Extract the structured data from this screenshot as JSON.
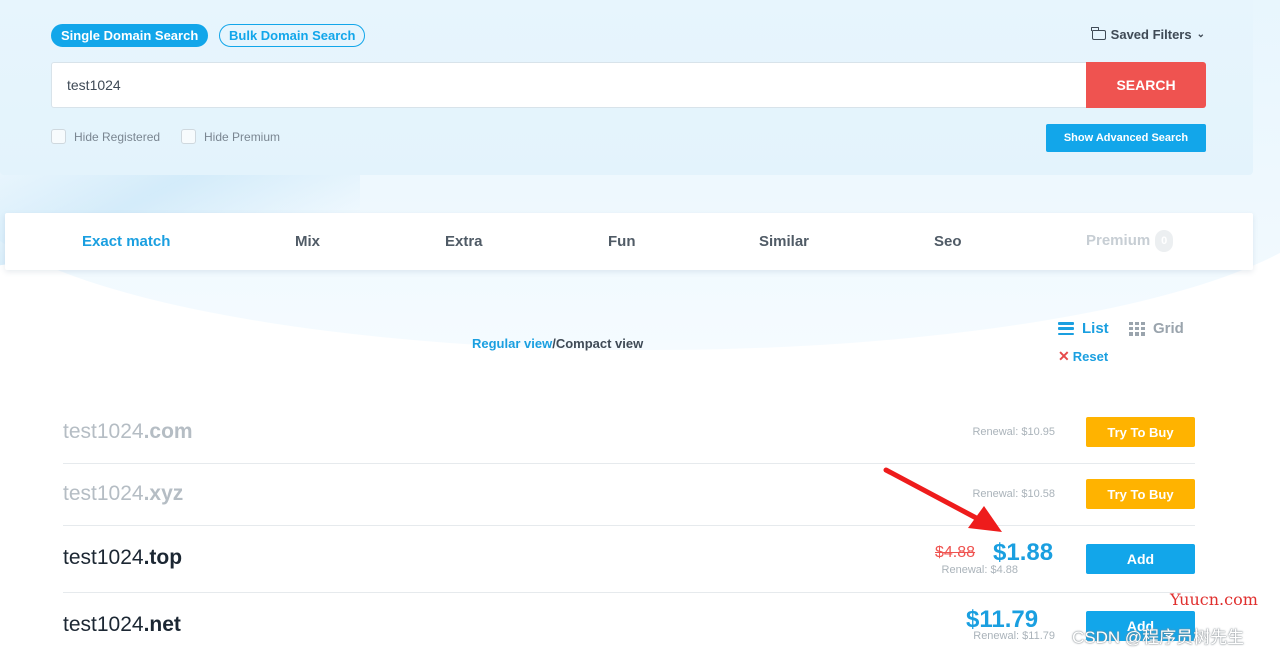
{
  "search": {
    "mode_single": "Single Domain Search",
    "mode_bulk": "Bulk Domain Search",
    "saved_filters": "Saved Filters",
    "query": "test1024",
    "button": "SEARCH",
    "hide_registered": "Hide Registered",
    "hide_premium": "Hide Premium",
    "advanced_button": "Show Advanced Search"
  },
  "tabs": [
    {
      "label": "Exact match",
      "active": true
    },
    {
      "label": "Mix"
    },
    {
      "label": "Extra"
    },
    {
      "label": "Fun"
    },
    {
      "label": "Similar"
    },
    {
      "label": "Seo"
    },
    {
      "label": "Premium",
      "badge": "0",
      "disabled": true
    }
  ],
  "view": {
    "regular": "Regular view",
    "separator": "/",
    "compact": "Compact view",
    "list": "List",
    "grid": "Grid",
    "reset": "Reset"
  },
  "results": [
    {
      "name": "test1024",
      "tld": ".com",
      "renewal": "Renewal: $10.95",
      "action": "Try To Buy",
      "status": "registered"
    },
    {
      "name": "test1024",
      "tld": ".xyz",
      "renewal": "Renewal: $10.58",
      "action": "Try To Buy",
      "status": "registered"
    },
    {
      "name": "test1024",
      "tld": ".top",
      "old_price": "$4.88",
      "price": "$1.88",
      "renewal": "Renewal: $4.88",
      "action": "Add",
      "status": "available"
    },
    {
      "name": "test1024",
      "tld": ".net",
      "price": "$11.79",
      "renewal": "Renewal: $11.79",
      "action": "Add",
      "status": "available"
    }
  ],
  "watermark": {
    "site": "Yuucn.com",
    "csdn": "CSDN @程序员树先生"
  },
  "colors": {
    "primary": "#12a6ea",
    "search": "#ef5350",
    "try_buy": "#ffb300",
    "arrow": "#ee1c1c"
  }
}
